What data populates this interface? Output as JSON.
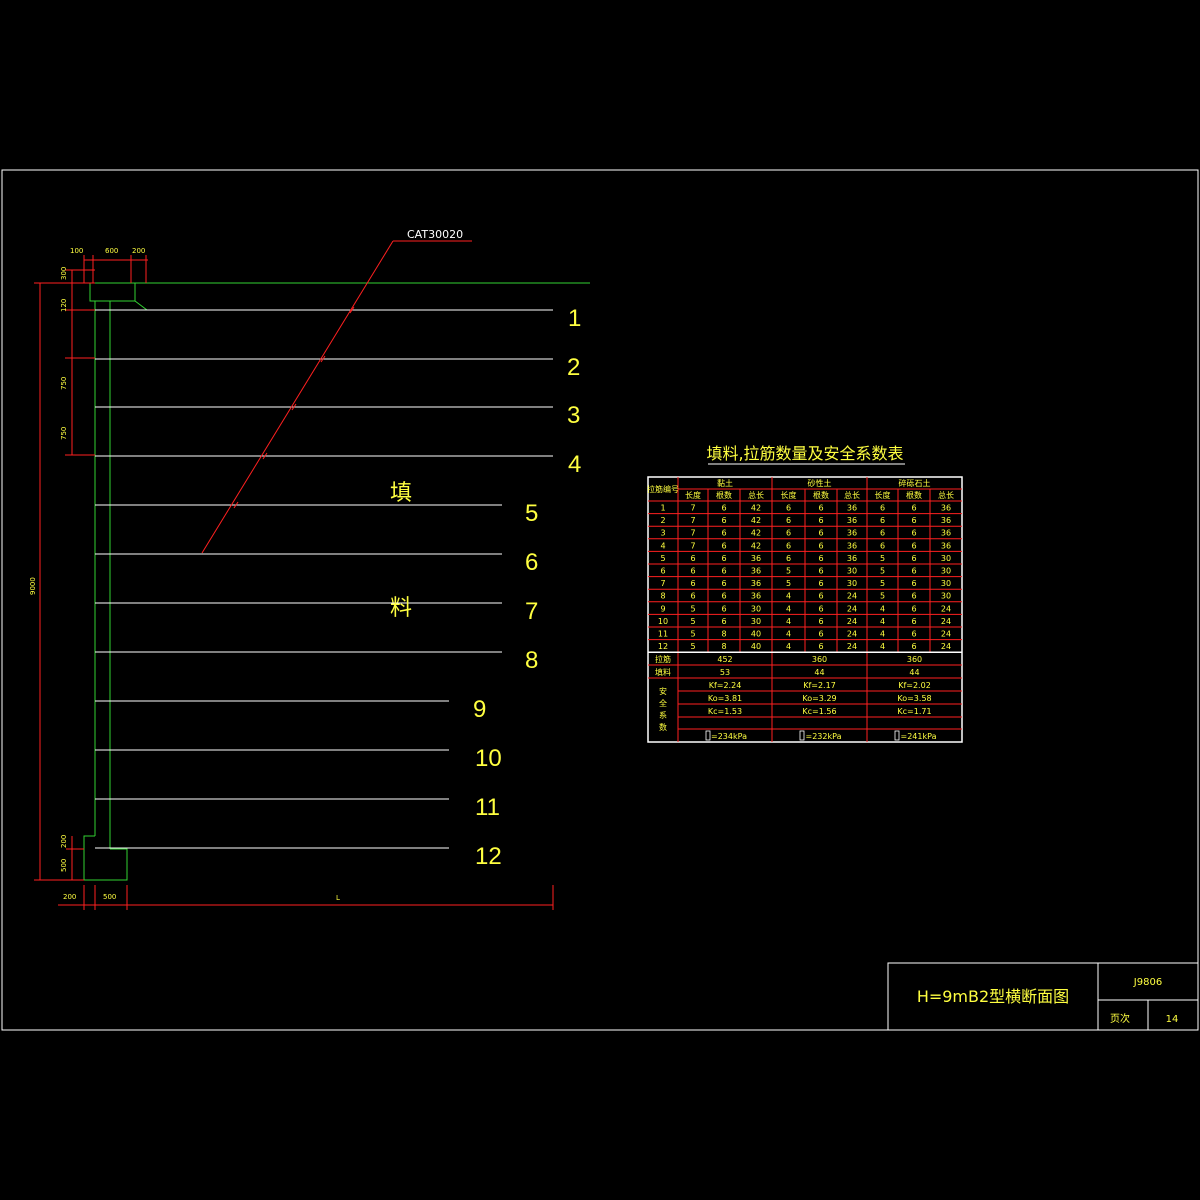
{
  "drawing": {
    "mesh_label": "CAT30020",
    "fill_chars": [
      "填",
      "料"
    ],
    "strip_numbers": [
      "1",
      "2",
      "3",
      "4",
      "5",
      "6",
      "7",
      "8",
      "9",
      "10",
      "11",
      "12"
    ],
    "dims": {
      "top": [
        "100",
        "600",
        "200"
      ],
      "left_300": "300",
      "left_120": "120",
      "left_750a": "750",
      "left_750b": "750",
      "total": "9000",
      "left_200": "200",
      "left_500": "500",
      "bottom_200": "200",
      "bottom_500": "500",
      "bottom_L": "L"
    }
  },
  "table": {
    "title": "填料,拉筋数量及安全系数表",
    "header_first": "拉筋编号",
    "groups": [
      "黏土",
      "砂性土",
      "碎砾石土"
    ],
    "subheaders": [
      "长度",
      "根数",
      "总长"
    ],
    "rows": [
      [
        "1",
        "7",
        "6",
        "42",
        "6",
        "6",
        "36",
        "6",
        "6",
        "36"
      ],
      [
        "2",
        "7",
        "6",
        "42",
        "6",
        "6",
        "36",
        "6",
        "6",
        "36"
      ],
      [
        "3",
        "7",
        "6",
        "42",
        "6",
        "6",
        "36",
        "6",
        "6",
        "36"
      ],
      [
        "4",
        "7",
        "6",
        "42",
        "6",
        "6",
        "36",
        "6",
        "6",
        "36"
      ],
      [
        "5",
        "6",
        "6",
        "36",
        "6",
        "6",
        "36",
        "5",
        "6",
        "30"
      ],
      [
        "6",
        "6",
        "6",
        "36",
        "5",
        "6",
        "30",
        "5",
        "6",
        "30"
      ],
      [
        "7",
        "6",
        "6",
        "36",
        "5",
        "6",
        "30",
        "5",
        "6",
        "30"
      ],
      [
        "8",
        "6",
        "6",
        "36",
        "4",
        "6",
        "24",
        "5",
        "6",
        "30"
      ],
      [
        "9",
        "5",
        "6",
        "30",
        "4",
        "6",
        "24",
        "4",
        "6",
        "24"
      ],
      [
        "10",
        "5",
        "6",
        "30",
        "4",
        "6",
        "24",
        "4",
        "6",
        "24"
      ],
      [
        "11",
        "5",
        "8",
        "40",
        "4",
        "6",
        "24",
        "4",
        "6",
        "24"
      ],
      [
        "12",
        "5",
        "8",
        "40",
        "4",
        "6",
        "24",
        "4",
        "6",
        "24"
      ]
    ],
    "summary": [
      {
        "label": "拉筋",
        "values": [
          "452",
          "360",
          "360"
        ]
      },
      {
        "label": "填料",
        "values": [
          "53",
          "44",
          "44"
        ]
      }
    ],
    "safety_label": [
      "安",
      "全",
      "系",
      "数"
    ],
    "safety_rows": [
      [
        "Kf=2.24",
        "Kf=2.17",
        "Kf=2.02"
      ],
      [
        "Ko=3.81",
        "Ko=3.29",
        "Ko=3.58"
      ],
      [
        "Kc=1.53",
        "Kc=1.56",
        "Kc=1.71"
      ],
      [
        "",
        "",
        ""
      ],
      [
        "=234kPa",
        "=232kPa",
        "=241kPa"
      ]
    ]
  },
  "title_block": {
    "title": "H=9mB2型横断面图",
    "code": "J9806",
    "sheet_label": "页次",
    "sheet_no": "14"
  }
}
